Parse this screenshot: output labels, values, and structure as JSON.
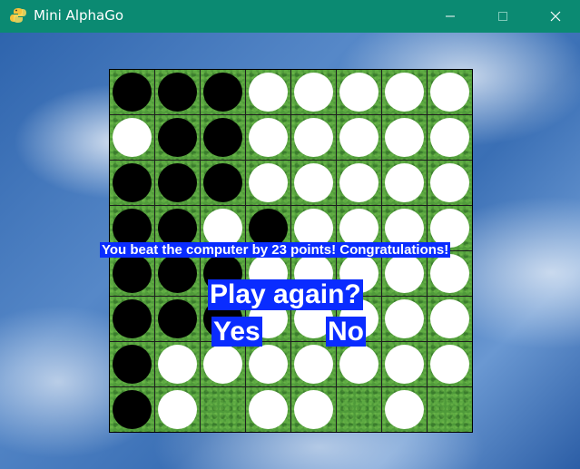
{
  "window": {
    "title": "Mini AlphaGo",
    "icon": "python-snake-icon",
    "controls": [
      "minimize",
      "maximize",
      "close"
    ],
    "titlebar_color": "#0b8a72"
  },
  "board": {
    "size": 8,
    "cell_color": "#4f9a3a",
    "grid": [
      [
        "B",
        "B",
        "B",
        "W",
        "W",
        "W",
        "W",
        "W"
      ],
      [
        "W",
        "B",
        "B",
        "W",
        "W",
        "W",
        "W",
        "W"
      ],
      [
        "B",
        "B",
        "B",
        "W",
        "W",
        "W",
        "W",
        "W"
      ],
      [
        "B",
        "B",
        "W",
        "B",
        "W",
        "W",
        "W",
        "W"
      ],
      [
        "B",
        "B",
        "B",
        "W",
        "W",
        "W",
        "W",
        "W"
      ],
      [
        "B",
        "B",
        "B",
        "W",
        "W",
        "W",
        "W",
        "W"
      ],
      [
        "B",
        "W",
        "W",
        "W",
        "W",
        "W",
        "W",
        "W"
      ],
      [
        "B",
        "W",
        "",
        "W",
        "W",
        "",
        "W",
        ""
      ]
    ]
  },
  "messages": {
    "result": "You beat the computer by 23 points! Congratulations!",
    "prompt": "Play again?",
    "yes": "Yes",
    "no": "No"
  },
  "colors": {
    "overlay_bg": "#0a2cff",
    "overlay_text": "#ffffff"
  }
}
